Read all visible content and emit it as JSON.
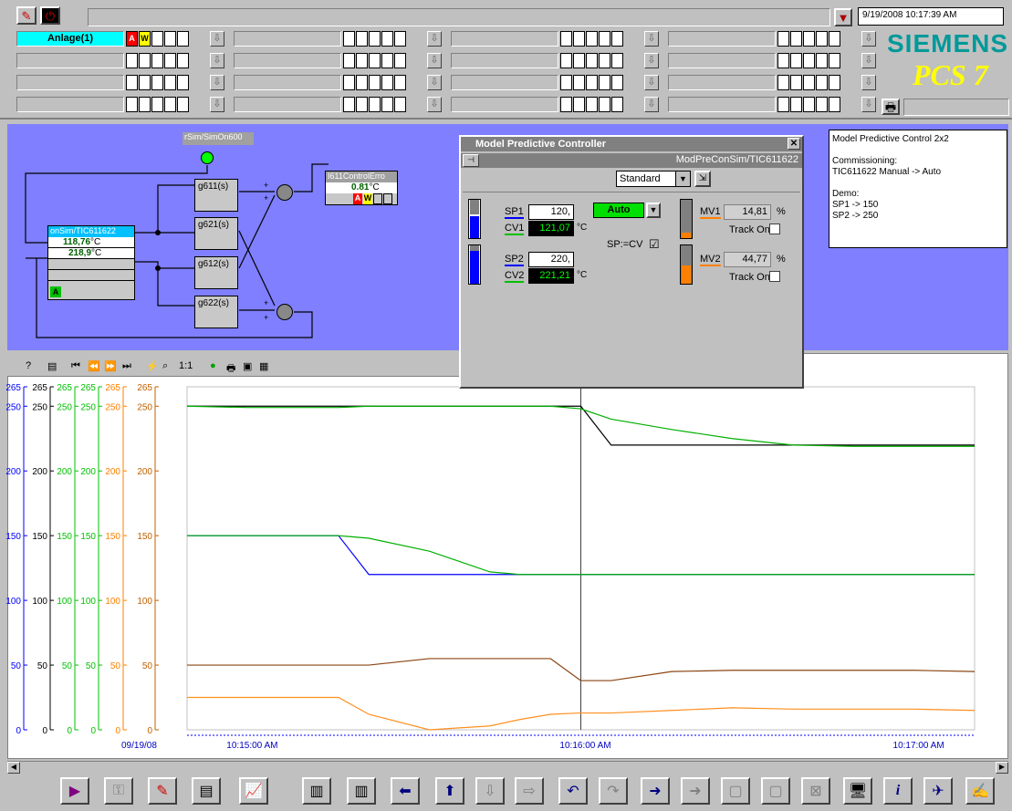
{
  "header": {
    "datetime": "9/19/2008 10:17:39 AM",
    "brand": "SIEMENS",
    "product": "PCS 7"
  },
  "areas": {
    "active": "Anlage(1)",
    "alarm_a": "A",
    "alarm_w": "W"
  },
  "plant": {
    "top_tag": "rSim/SimOn600",
    "controller_tag": "onSim/TIC611622",
    "cv1": "118,76",
    "cv2": "218,9",
    "unit": "°C",
    "status": "A",
    "blocks": [
      "g611(s)",
      "g621(s)",
      "g612(s)",
      "g622(s)"
    ],
    "err_tag": "I611ControlErro",
    "err_value": "0.81",
    "err_unit": "°C",
    "err_a": "A",
    "err_w": "W",
    "plus": "+"
  },
  "note": {
    "lines": [
      "Model Predictive Control 2x2",
      "",
      "Commissioning:",
      "TIC611622 Manual -> Auto",
      "",
      "Demo:",
      "SP1 -> 150",
      "SP2 -> 250"
    ]
  },
  "faceplate": {
    "title": "Model Predictive Controller",
    "tag": "ModPreConSim/TIC611622",
    "view": "Standard",
    "mode": "Auto",
    "sp1_label": "SP1",
    "sp1": "120,",
    "cv1_label": "CV1",
    "cv1": "121,07",
    "unit": "°C",
    "sp2_label": "SP2",
    "sp2": "220,",
    "cv2_label": "CV2",
    "cv2": "221,21",
    "spcv": "SP:=CV",
    "check": "☑",
    "mv1_label": "MV1",
    "mv1": "14,81",
    "mv2_label": "MV2",
    "mv2": "44,77",
    "pct": "%",
    "track": "Track On"
  },
  "trend": {
    "date": "09/19/08",
    "xticks": [
      "10:15:00 AM",
      "10:16:00 AM",
      "10:17:00 AM"
    ],
    "axes_colors": [
      "#0000ff",
      "#000000",
      "#00c000",
      "#00c000",
      "#ff8000",
      "#c06000"
    ]
  },
  "chart_data": {
    "type": "line",
    "ylim": [
      0,
      265
    ],
    "y_ticks": [
      0,
      50,
      100,
      150,
      200,
      250,
      265
    ],
    "x_ticks": [
      "10:15:00 AM",
      "10:16:00 AM",
      "10:17:00 AM"
    ],
    "x": [
      0,
      10,
      20,
      25,
      30,
      40,
      50,
      55,
      60,
      65,
      70,
      80,
      90,
      100,
      110,
      120,
      130
    ],
    "series": [
      {
        "color": "#0000ff",
        "values": [
          150,
          150,
          150,
          150,
          120,
          120,
          120,
          120,
          120,
          120,
          120,
          120,
          120,
          120,
          120,
          120,
          120
        ]
      },
      {
        "color": "#000000",
        "values": [
          250,
          250,
          250,
          250,
          250,
          250,
          250,
          250,
          250,
          250,
          220,
          220,
          220,
          220,
          220,
          220,
          220
        ]
      },
      {
        "color": "#00b000",
        "values": [
          150,
          150,
          150,
          150,
          148,
          138,
          122,
          120,
          120,
          120,
          120,
          120,
          120,
          120,
          120,
          120,
          120
        ]
      },
      {
        "color": "#00b000",
        "values": [
          250,
          249,
          249,
          249,
          250,
          250,
          250,
          250,
          250,
          248,
          240,
          232,
          225,
          220,
          219,
          219,
          219
        ]
      },
      {
        "color": "#ff9020",
        "values": [
          25,
          25,
          25,
          25,
          12,
          0,
          3,
          8,
          12,
          13,
          13,
          15,
          17,
          16,
          16,
          16,
          15
        ]
      },
      {
        "color": "#8b4513",
        "values": [
          50,
          50,
          50,
          50,
          50,
          55,
          55,
          55,
          55,
          38,
          38,
          45,
          46,
          46,
          46,
          46,
          45
        ]
      }
    ]
  }
}
